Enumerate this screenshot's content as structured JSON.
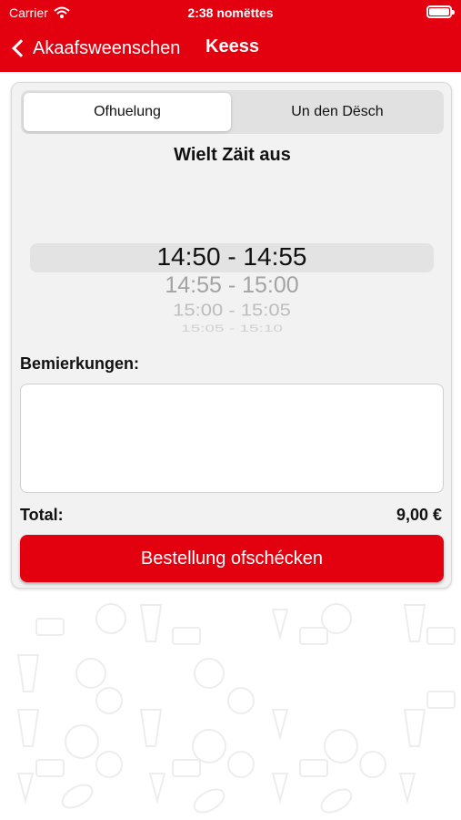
{
  "status_bar": {
    "carrier": "Carrier",
    "time": "2:38 nomëttes"
  },
  "nav": {
    "back_label": "Akaafsweenschen",
    "title": "Keess"
  },
  "segment": {
    "pickup": "Ofhuelung",
    "table": "Un den Dësch",
    "selected": "pickup"
  },
  "time_picker": {
    "title": "Wielt Zäit aus",
    "selected": "14:50 - 14:55",
    "options": [
      "14:50 - 14:55",
      "14:55 - 15:00",
      "15:00 - 15:05",
      "15:05 - 15:10"
    ]
  },
  "remarks": {
    "label": "Bemierkungen:",
    "value": ""
  },
  "total": {
    "label": "Total:",
    "value": "9,00 €"
  },
  "checkout_button": "Bestellung ofschécken",
  "colors": {
    "brand_red": "#e3000f",
    "card_bg": "#f2f2f2"
  },
  "icons": [
    "back-chevron-icon",
    "wifi-icon",
    "battery-icon",
    "food-pattern"
  ]
}
